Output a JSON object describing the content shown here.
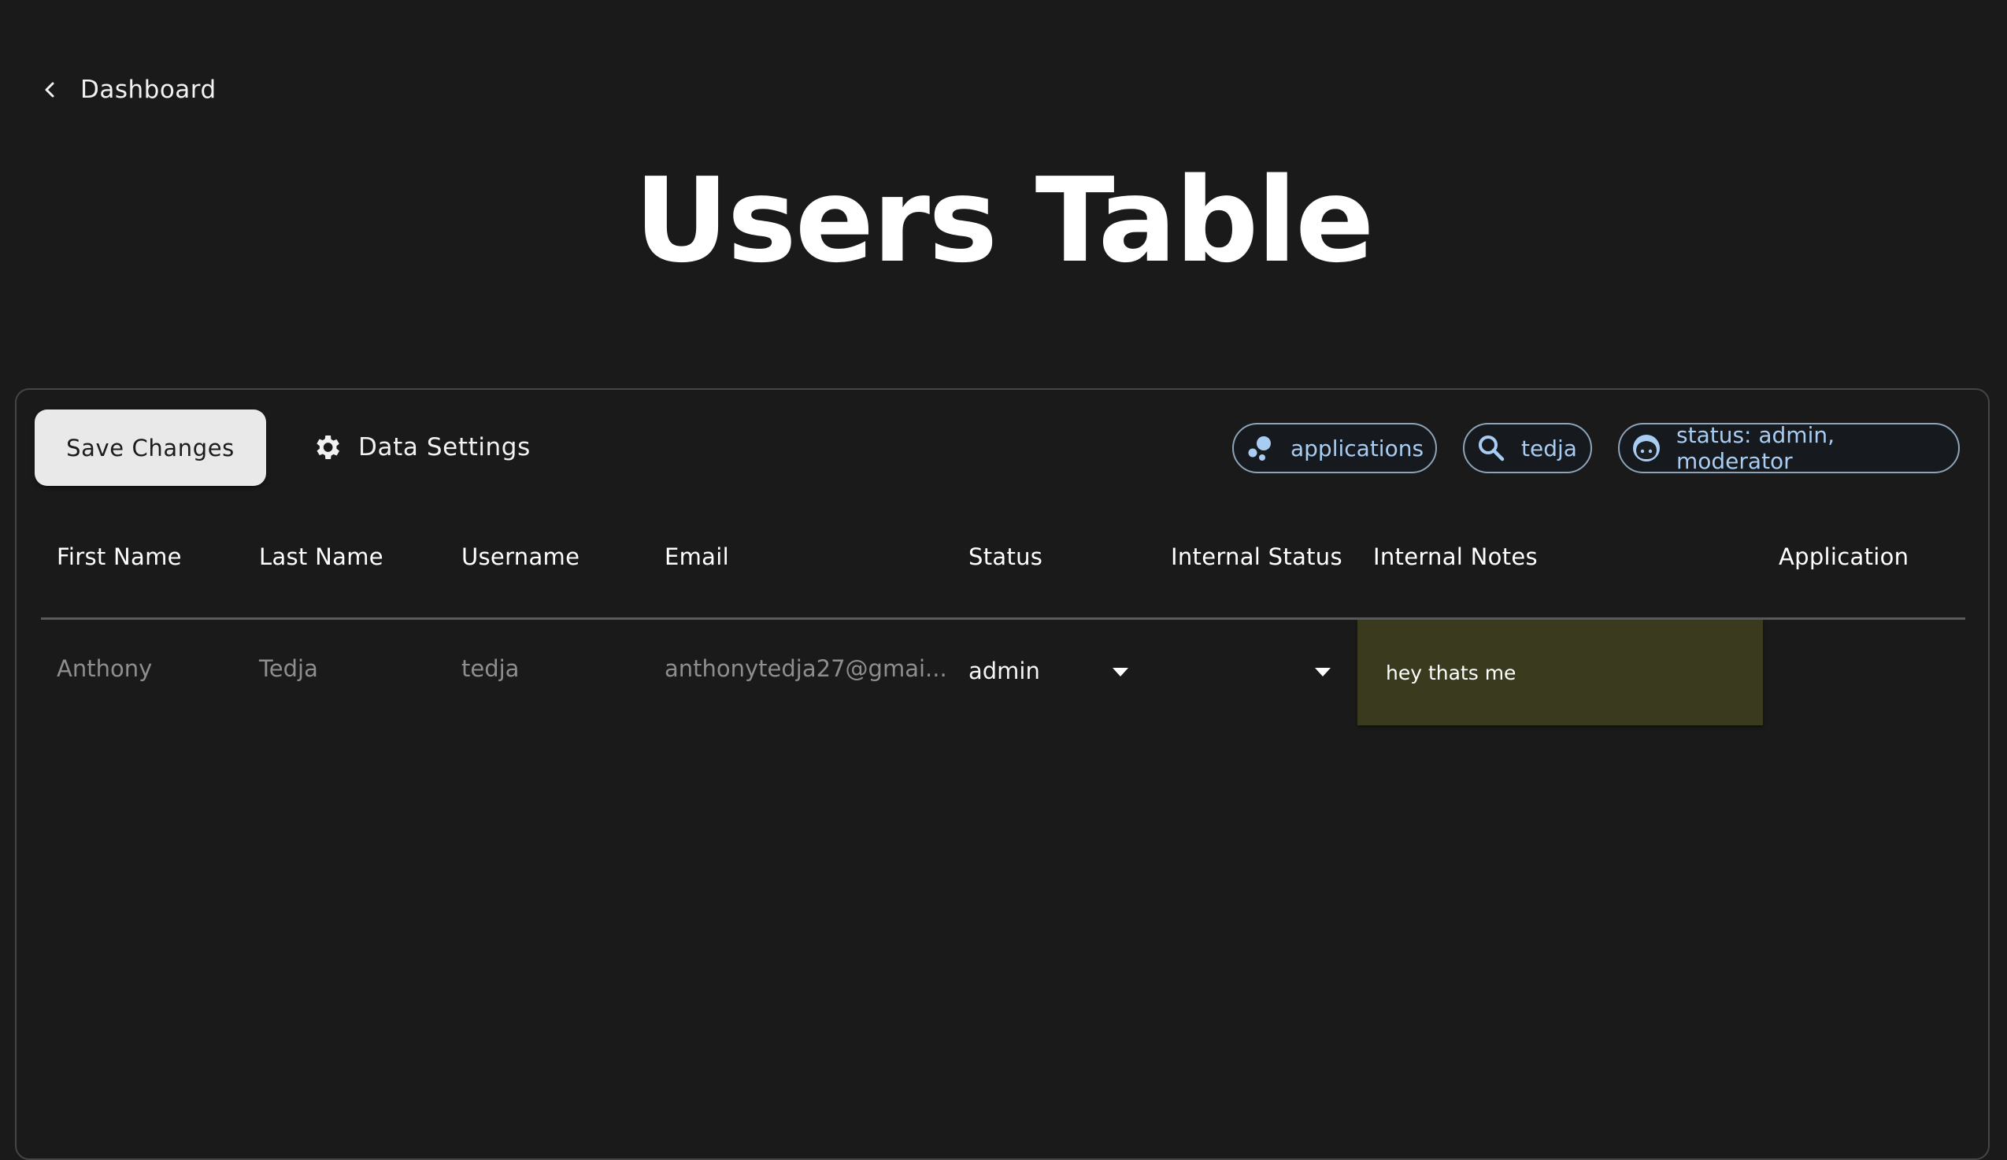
{
  "nav": {
    "back_label": "Dashboard",
    "back_icon": "chevron-left-icon"
  },
  "page": {
    "title": "Users Table"
  },
  "toolbar": {
    "save_label": "Save Changes",
    "settings_label": "Data Settings",
    "settings_icon": "gear-icon",
    "filters": [
      {
        "icon": "bubbles-icon",
        "label": "applications"
      },
      {
        "icon": "search-icon",
        "label": "tedja"
      },
      {
        "icon": "face-icon",
        "label": "status: admin, moderator"
      }
    ],
    "accent_color": "#a9cdf2"
  },
  "table": {
    "columns": [
      "First Name",
      "Last Name",
      "Username",
      "Email",
      "Status",
      "Internal Status",
      "Internal Notes",
      "Application"
    ],
    "rows": [
      {
        "first_name": "Anthony",
        "last_name": "Tedja",
        "username": "tedja",
        "email": "anthonytedja27@gmai...",
        "status": "admin",
        "internal_status": "",
        "internal_notes": "hey thats me",
        "application": ""
      }
    ],
    "notes_highlight_color": "#3a3b1e"
  }
}
